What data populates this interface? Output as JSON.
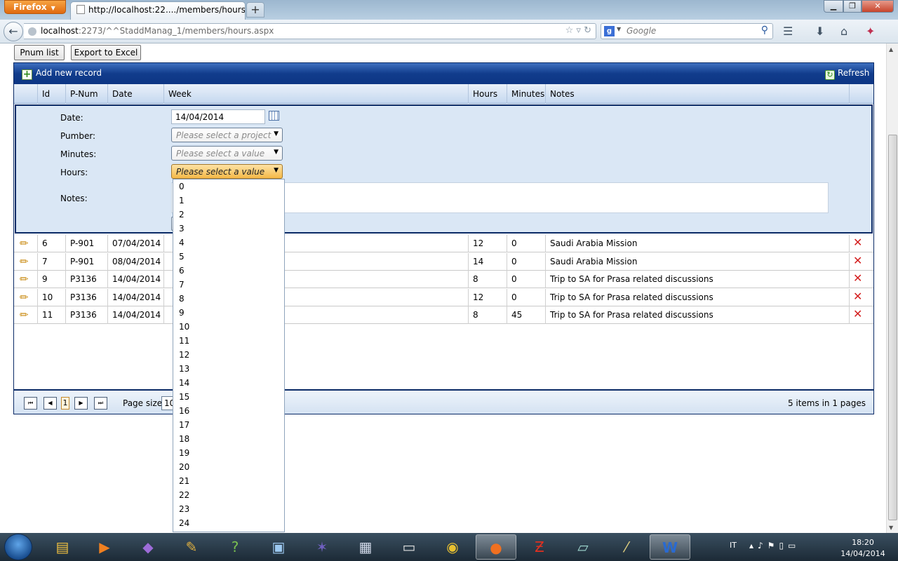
{
  "browser": {
    "app_button": "Firefox",
    "tab_title": "http://localhost:22..../members/hours.aspx",
    "new_tab": "+",
    "url_host": "localhost",
    "url_rest": ":2273/^^StaddManag_1/members/hours.aspx",
    "search_placeholder": "Google",
    "search_engine_letter": "g"
  },
  "page": {
    "pnum_list_label": "Pnum list",
    "export_label": "Export to Excel"
  },
  "grid": {
    "add_label": "Add new record",
    "refresh_label": "Refresh",
    "columns": [
      "Id",
      "P-Num",
      "Date",
      "Week",
      "Hours",
      "Minutes",
      "Notes"
    ],
    "form": {
      "date_label": "Date:",
      "date_value": "14/04/2014",
      "pnum_label": "Pumber:",
      "pnum_placeholder": "Please select a project",
      "minutes_label": "Minutes:",
      "minutes_placeholder": "Please select a value",
      "hours_label": "Hours:",
      "hours_placeholder": "Please select a value",
      "notes_label": "Notes:"
    },
    "rows": [
      {
        "id": "6",
        "pnum": "P-901",
        "date": "07/04/2014",
        "hours": "12",
        "minutes": "0",
        "notes": "Saudi Arabia Mission"
      },
      {
        "id": "7",
        "pnum": "P-901",
        "date": "08/04/2014",
        "hours": "14",
        "minutes": "0",
        "notes": "Saudi Arabia Mission"
      },
      {
        "id": "9",
        "pnum": "P3136",
        "date": "14/04/2014",
        "hours": "8",
        "minutes": "0",
        "notes": "Trip to SA for Prasa related discussions"
      },
      {
        "id": "10",
        "pnum": "P3136",
        "date": "14/04/2014",
        "hours": "12",
        "minutes": "0",
        "notes": "Trip to SA for Prasa related discussions"
      },
      {
        "id": "11",
        "pnum": "P3136",
        "date": "14/04/2014",
        "hours": "8",
        "minutes": "45",
        "notes": "Trip to SA for Prasa related discussions"
      }
    ],
    "pager": {
      "current_page": "1",
      "page_size_label": "Page size:",
      "page_size_value": "10",
      "items_info": "5 items in 1 pages"
    }
  },
  "hours_options": [
    "0",
    "1",
    "2",
    "3",
    "4",
    "5",
    "6",
    "7",
    "8",
    "9",
    "10",
    "11",
    "12",
    "13",
    "14",
    "15",
    "16",
    "17",
    "18",
    "19",
    "20",
    "21",
    "22",
    "23",
    "24"
  ],
  "taskbar": {
    "language": "IT",
    "time": "18:20",
    "date": "14/04/2014"
  }
}
